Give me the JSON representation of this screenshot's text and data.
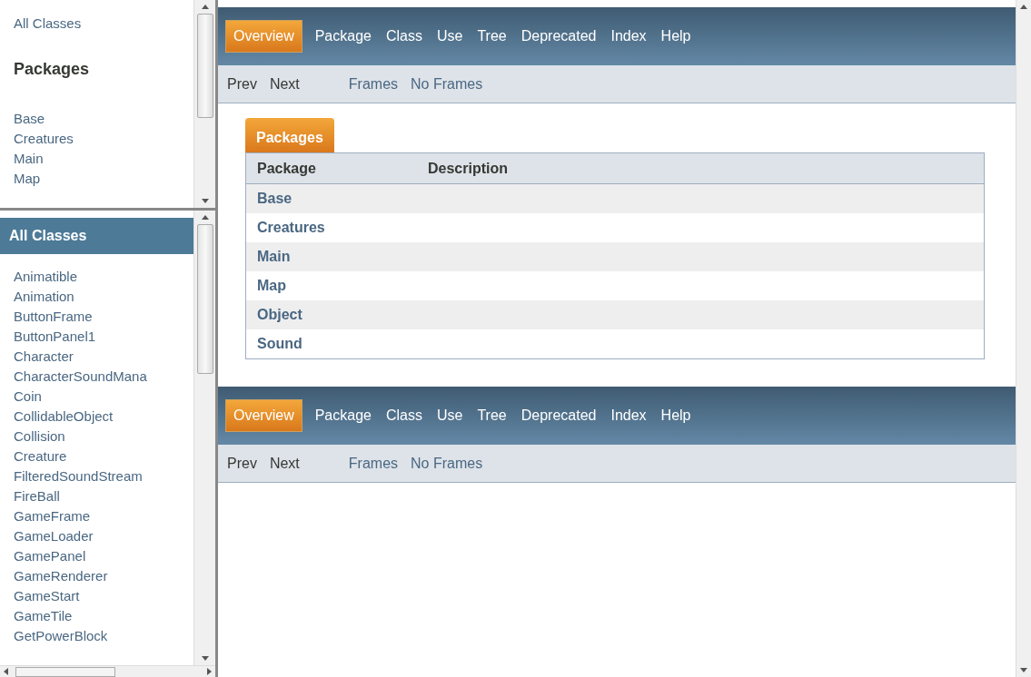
{
  "packages_frame": {
    "all_classes_link": "All Classes",
    "heading": "Packages",
    "packages": [
      "Base",
      "Creatures",
      "Main",
      "Map"
    ]
  },
  "classes_frame": {
    "heading": "All Classes",
    "classes": [
      "Animatible",
      "Animation",
      "ButtonFrame",
      "ButtonPanel1",
      "Character",
      "CharacterSoundMana",
      "Coin",
      "CollidableObject",
      "Collision",
      "Creature",
      "FilteredSoundStream",
      "FireBall",
      "GameFrame",
      "GameLoader",
      "GamePanel",
      "GameRenderer",
      "GameStart",
      "GameTile",
      "GetPowerBlock"
    ]
  },
  "top_nav": {
    "items": [
      {
        "label": "Overview",
        "selected": true
      },
      {
        "label": "Package",
        "selected": false
      },
      {
        "label": "Class",
        "selected": false
      },
      {
        "label": "Use",
        "selected": false
      },
      {
        "label": "Tree",
        "selected": false
      },
      {
        "label": "Deprecated",
        "selected": false
      },
      {
        "label": "Index",
        "selected": false
      },
      {
        "label": "Help",
        "selected": false
      }
    ],
    "sub_items": [
      {
        "label": "Prev",
        "kind": "text"
      },
      {
        "label": "Next",
        "kind": "text"
      },
      {
        "label": "Frames",
        "kind": "link"
      },
      {
        "label": "No Frames",
        "kind": "link"
      }
    ]
  },
  "packages_table": {
    "caption": "Packages",
    "columns": [
      "Package",
      "Description"
    ],
    "rows": [
      "Base",
      "Creatures",
      "Main",
      "Map",
      "Object",
      "Sound"
    ]
  },
  "bottom_nav": {
    "items": [
      {
        "label": "Overview",
        "selected": true
      },
      {
        "label": "Package",
        "selected": false
      },
      {
        "label": "Class",
        "selected": false
      },
      {
        "label": "Use",
        "selected": false
      },
      {
        "label": "Tree",
        "selected": false
      },
      {
        "label": "Deprecated",
        "selected": false
      },
      {
        "label": "Index",
        "selected": false
      },
      {
        "label": "Help",
        "selected": false
      }
    ],
    "sub_items": [
      {
        "label": "Prev",
        "kind": "text"
      },
      {
        "label": "Next",
        "kind": "text"
      },
      {
        "label": "Frames",
        "kind": "link"
      },
      {
        "label": "No Frames",
        "kind": "link"
      }
    ]
  }
}
